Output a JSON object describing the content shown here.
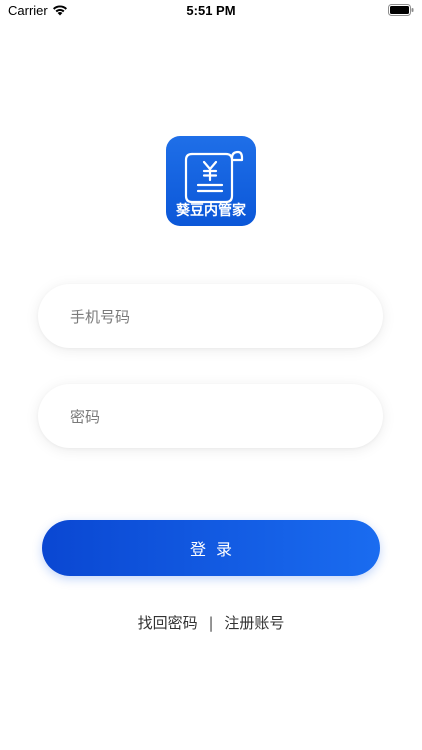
{
  "status_bar": {
    "carrier": "Carrier",
    "time": "5:51 PM"
  },
  "logo": {
    "text": "葵豆内管家",
    "symbol": "羊"
  },
  "form": {
    "phone_placeholder": "手机号码",
    "password_placeholder": "密码",
    "login_label": "登录"
  },
  "links": {
    "forgot_password": "找回密码",
    "divider": "|",
    "register": "注册账号"
  },
  "colors": {
    "brand_blue": "#0b57d8",
    "button_gradient_start": "#0a47d2",
    "button_gradient_end": "#1a6cf0"
  }
}
